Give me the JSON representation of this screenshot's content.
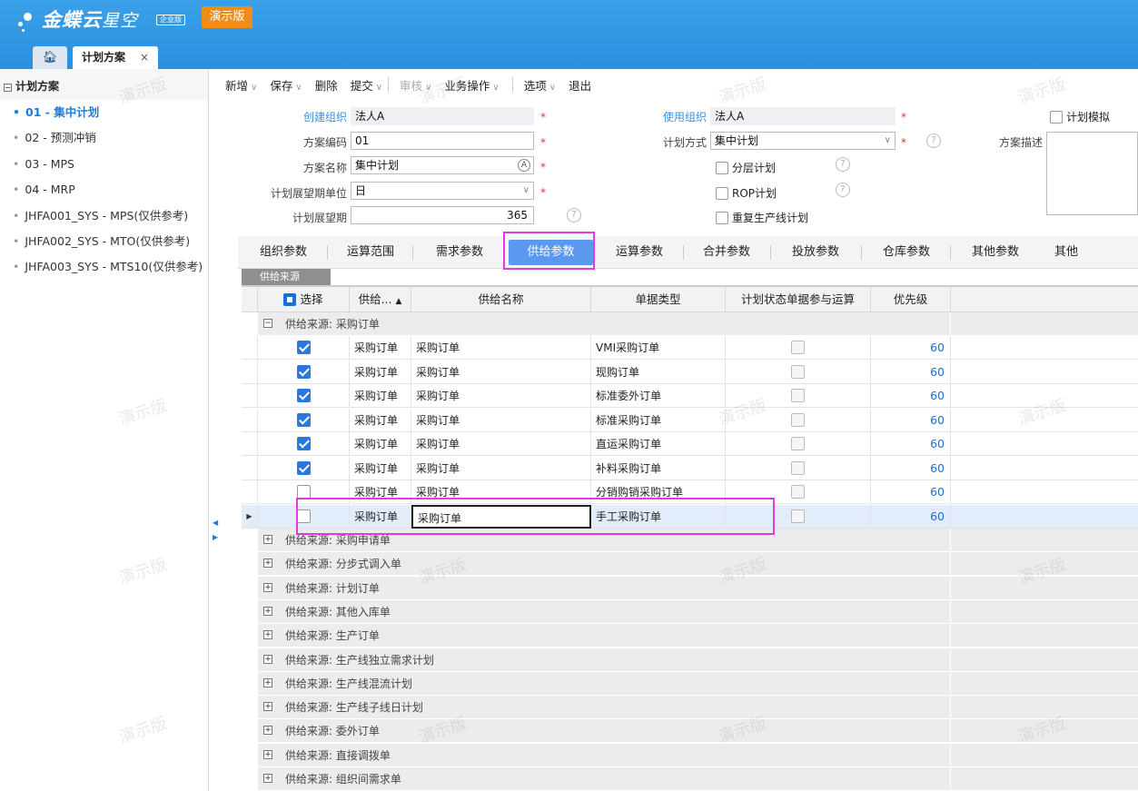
{
  "app": {
    "brand": "金蝶云",
    "brand_sub": "星空",
    "edition": "企业版",
    "demo_badge": "演示版",
    "open_tab": "计划方案",
    "watermark": "演示版"
  },
  "sidebar": {
    "root": "计划方案",
    "items": [
      {
        "label": "01 - 集中计划",
        "active": true
      },
      {
        "label": "02 - 预测冲销"
      },
      {
        "label": "03 - MPS"
      },
      {
        "label": "04 - MRP"
      },
      {
        "label": "JHFA001_SYS - MPS(仅供参考)"
      },
      {
        "label": "JHFA002_SYS - MTO(仅供参考)"
      },
      {
        "label": "JHFA003_SYS - MTS10(仅供参考)"
      }
    ]
  },
  "toolbar": {
    "new": "新增",
    "save": "保存",
    "delete": "删除",
    "submit": "提交",
    "audit": "审核",
    "business": "业务操作",
    "options": "选项",
    "exit": "退出"
  },
  "form": {
    "create_org_label": "创建组织",
    "create_org": "法人A",
    "use_org_label": "使用组织",
    "use_org": "法人A",
    "plan_sim_label": "计划模拟",
    "code_label": "方案编码",
    "code": "01",
    "plan_mode_label": "计划方式",
    "plan_mode": "集中计划",
    "desc_label": "方案描述",
    "name_label": "方案名称",
    "name": "集中计划",
    "layered_label": "分层计划",
    "unit_label": "计划展望期单位",
    "unit": "日",
    "rop_label": "ROP计划",
    "period_label": "计划展望期",
    "period": "365",
    "repeat_label": "重复生产线计划"
  },
  "tabs": [
    "组织参数",
    "运算范围",
    "需求参数",
    "供给参数",
    "运算参数",
    "合并参数",
    "投放参数",
    "仓库参数",
    "其他参数",
    "其他"
  ],
  "active_tab": "供给参数",
  "subtab": "供给来源",
  "grid": {
    "headers": {
      "select": "选择",
      "supply_code": "供给...",
      "supply_name": "供给名称",
      "doc_type": "单据类型",
      "plan_status": "计划状态单据参与运算",
      "priority": "优先级"
    },
    "expanded_group": "供给来源: 采购订单",
    "rows": [
      {
        "selected": true,
        "code": "采购订单",
        "name": "采购订单",
        "type": "VMI采购订单",
        "priority": "60"
      },
      {
        "selected": true,
        "code": "采购订单",
        "name": "采购订单",
        "type": "现购订单",
        "priority": "60"
      },
      {
        "selected": true,
        "code": "采购订单",
        "name": "采购订单",
        "type": "标准委外订单",
        "priority": "60"
      },
      {
        "selected": true,
        "code": "采购订单",
        "name": "采购订单",
        "type": "标准采购订单",
        "priority": "60"
      },
      {
        "selected": true,
        "code": "采购订单",
        "name": "采购订单",
        "type": "直运采购订单",
        "priority": "60"
      },
      {
        "selected": true,
        "code": "采购订单",
        "name": "采购订单",
        "type": "补料采购订单",
        "priority": "60"
      },
      {
        "selected": false,
        "code": "采购订单",
        "name": "采购订单",
        "type": "分销购销采购订单",
        "priority": "60"
      },
      {
        "selected": false,
        "code": "采购订单",
        "name": "采购订单",
        "type": "手工采购订单",
        "priority": "60",
        "current": true
      }
    ],
    "collapsed_groups": [
      "供给来源: 采购申请单",
      "供给来源: 分步式调入单",
      "供给来源: 计划订单",
      "供给来源: 其他入库单",
      "供给来源: 生产订单",
      "供给来源: 生产线独立需求计划",
      "供给来源: 生产线混流计划",
      "供给来源: 生产线子线日计划",
      "供给来源: 委外订单",
      "供给来源: 直接调拨单",
      "供给来源: 组织间需求单"
    ]
  }
}
